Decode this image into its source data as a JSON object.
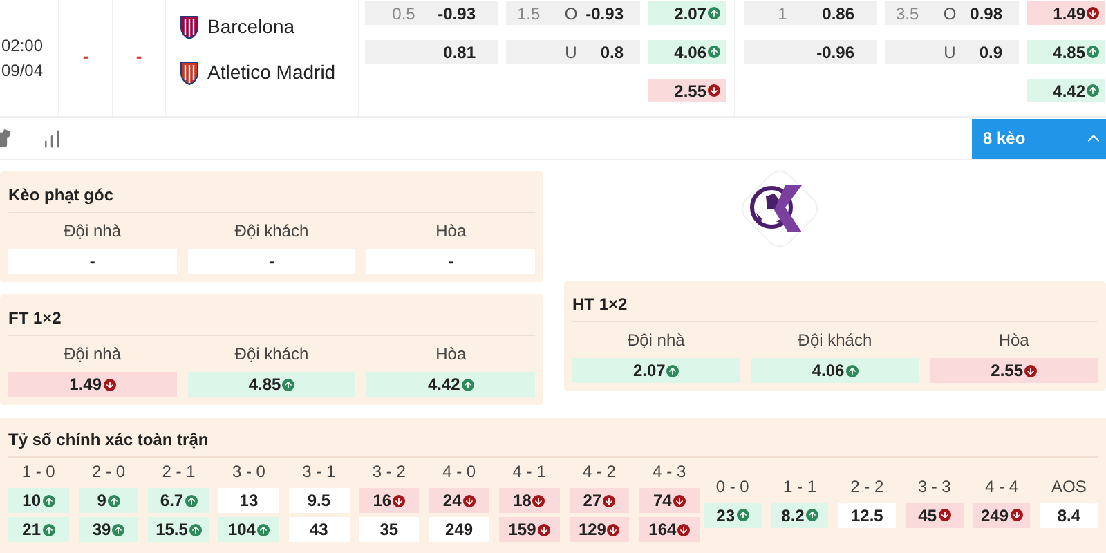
{
  "match": {
    "time": "02:00",
    "date": "09/04",
    "score_home": "-",
    "score_away": "-",
    "teams": [
      {
        "name": "Barcelona",
        "color": "#a50044"
      },
      {
        "name": "Atletico Madrid",
        "color": "#cb3524"
      }
    ],
    "markets": [
      {
        "kind": "handicap",
        "rows": [
          {
            "line": "0.5",
            "value": "-0.93"
          },
          {
            "value": "0.81"
          }
        ]
      },
      {
        "kind": "over_under",
        "rows": [
          {
            "line": "1.5",
            "side": "O",
            "value": "-0.93"
          },
          {
            "side": "U",
            "value": "0.8"
          }
        ]
      },
      {
        "kind": "result",
        "rows": [
          {
            "value": "2.07",
            "up": true,
            "down": false
          },
          {
            "value": "4.06",
            "up": true,
            "down": false
          },
          {
            "value": "2.55",
            "up": false,
            "down": true
          }
        ]
      },
      {
        "kind": "handicap",
        "rows": [
          {
            "line": "1",
            "value": "0.86"
          },
          {
            "value": "-0.96"
          }
        ]
      },
      {
        "kind": "over_under",
        "rows": [
          {
            "line": "3.5",
            "side": "O",
            "value": "0.98"
          },
          {
            "side": "U",
            "value": "0.9"
          }
        ]
      },
      {
        "kind": "result",
        "rows": [
          {
            "value": "1.49",
            "up": false,
            "down": true
          },
          {
            "value": "4.85",
            "up": true,
            "down": false
          },
          {
            "value": "4.42",
            "up": true,
            "down": false
          }
        ]
      }
    ]
  },
  "toolbar": {
    "more_button": {
      "label": "8 kèo",
      "expanded": true
    }
  },
  "corner_panel": {
    "title": "Kèo phạt góc",
    "columns": [
      {
        "label": "Đội nhà",
        "value": "-",
        "up": false,
        "down": false
      },
      {
        "label": "Đội khách",
        "value": "-",
        "up": false,
        "down": false
      },
      {
        "label": "Hòa",
        "value": "-",
        "up": false,
        "down": false
      }
    ]
  },
  "ft_panel": {
    "title": "FT 1×2",
    "columns": [
      {
        "label": "Đội nhà",
        "value": "1.49",
        "up": false,
        "down": true
      },
      {
        "label": "Đội khách",
        "value": "4.85",
        "up": true,
        "down": false
      },
      {
        "label": "Hòa",
        "value": "4.42",
        "up": true,
        "down": false
      }
    ]
  },
  "ht_panel": {
    "title": "HT 1×2",
    "columns": [
      {
        "label": "Đội nhà",
        "value": "2.07",
        "up": true,
        "down": false
      },
      {
        "label": "Đội khách",
        "value": "4.06",
        "up": true,
        "down": false
      },
      {
        "label": "Hòa",
        "value": "2.55",
        "up": false,
        "down": true
      }
    ]
  },
  "exact_score": {
    "title": "Tỷ số chính xác toàn trận",
    "groups": [
      {
        "columns": [
          {
            "score": "1 - 0",
            "values": [
              {
                "value": "10",
                "up": true,
                "down": false
              },
              {
                "value": "21",
                "up": true,
                "down": false
              }
            ]
          },
          {
            "score": "2 - 0",
            "values": [
              {
                "value": "9",
                "up": true,
                "down": false
              },
              {
                "value": "39",
                "up": true,
                "down": false
              }
            ]
          },
          {
            "score": "2 - 1",
            "values": [
              {
                "value": "6.7",
                "up": true,
                "down": false
              },
              {
                "value": "15.5",
                "up": true,
                "down": false
              }
            ]
          },
          {
            "score": "3 - 0",
            "values": [
              {
                "value": "13",
                "up": false,
                "down": false
              },
              {
                "value": "104",
                "up": true,
                "down": false
              }
            ]
          },
          {
            "score": "3 - 1",
            "values": [
              {
                "value": "9.5",
                "up": false,
                "down": false
              },
              {
                "value": "43",
                "up": false,
                "down": false
              }
            ]
          },
          {
            "score": "3 - 2",
            "values": [
              {
                "value": "16",
                "up": false,
                "down": true
              },
              {
                "value": "35",
                "up": false,
                "down": false
              }
            ]
          },
          {
            "score": "4 - 0",
            "values": [
              {
                "value": "24",
                "up": false,
                "down": true
              },
              {
                "value": "249",
                "up": false,
                "down": false
              }
            ]
          },
          {
            "score": "4 - 1",
            "values": [
              {
                "value": "18",
                "up": false,
                "down": true
              },
              {
                "value": "159",
                "up": false,
                "down": true
              }
            ]
          },
          {
            "score": "4 - 2",
            "values": [
              {
                "value": "27",
                "up": false,
                "down": true
              },
              {
                "value": "129",
                "up": false,
                "down": true
              }
            ]
          },
          {
            "score": "4 - 3",
            "values": [
              {
                "value": "74",
                "up": false,
                "down": true
              },
              {
                "value": "164",
                "up": false,
                "down": true
              }
            ]
          }
        ]
      },
      {
        "columns": [
          {
            "score": "0 - 0",
            "values": [
              {
                "value": "23",
                "up": true,
                "down": false
              }
            ]
          },
          {
            "score": "1 - 1",
            "values": [
              {
                "value": "8.2",
                "up": true,
                "down": false
              }
            ]
          },
          {
            "score": "2 - 2",
            "values": [
              {
                "value": "12.5",
                "up": false,
                "down": false
              }
            ]
          },
          {
            "score": "3 - 3",
            "values": [
              {
                "value": "45",
                "up": false,
                "down": true
              }
            ]
          },
          {
            "score": "4 - 4",
            "values": [
              {
                "value": "249",
                "up": false,
                "down": true
              }
            ]
          },
          {
            "score": "AOS",
            "values": [
              {
                "value": "8.4",
                "up": false,
                "down": false
              }
            ]
          }
        ]
      }
    ]
  }
}
